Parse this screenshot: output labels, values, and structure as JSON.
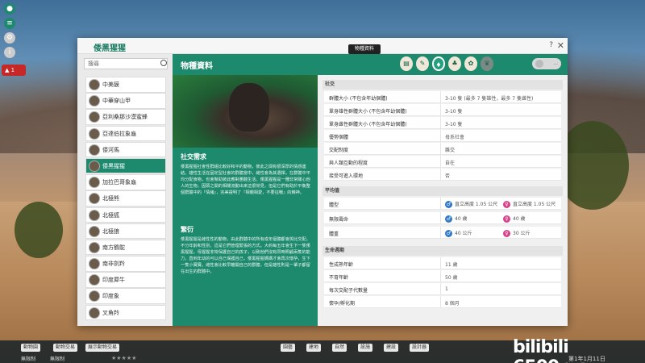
{
  "window": {
    "title": "倭黑猩猩",
    "help": "?",
    "close": "✕"
  },
  "search": {
    "placeholder": "搜尋"
  },
  "species": [
    "中美貘",
    "中華穿山甲",
    "亞利桑那沙漠蜜蜂",
    "亞達伯拉象龜",
    "倭河馬",
    "倭黑猩猩",
    "加拉巴哥象龜",
    "北極熊",
    "北極狐",
    "北極狼",
    "南方鶴鴕",
    "南非劍羚",
    "印度犀牛",
    "印度象",
    "叉角羚"
  ],
  "selected_index": 5,
  "header": {
    "title": "物種資料",
    "tooltip": "物種資料",
    "tabs": [
      "doc-icon",
      "pen-icon",
      "species-icon",
      "tree-icon",
      "paw-icon",
      "trophy-icon"
    ],
    "right_button": "..."
  },
  "info": {
    "social_title": "社交需求",
    "social_text": "倭黑猩猩社會性群組比較好和平的動物，彼此之間有很深厚的情感連結。雄性生活在固定型社會的群體當中，雌性會為其選擇。在群體中平均分配食物，也會幫助彼此應對團體生活。倭黑猩猩是一種非常關心他人的生物，因頭之間的相關流動出來這很常見，但是它們有助於平衡整個群體中的『情緒』，完美證明了『相親相愛，不要征戰』的精神。",
    "breeding_title": "繁衍",
    "breeding_text": "倭黑猩猩是雌性性的動物，由此群體中的所有成年個體都會與比交配，不分年齡和性別，這是它們管理緊張的方式。大約每五年會生下一隻倭黑猩猩，母猩猩非常保護自己的孩子，以致他們沒有同時照顧兩隻的能力，直到年幼的可以自己保護自己，倭黑猩猩媽媽才會再次懷孕，生下一隻小寶寶。雌性會比較早離開自己的群體，但是雄性則是一輩子都留在出生的群體中。"
  },
  "sections": {
    "social": {
      "title": "社交",
      "rows": [
        {
          "k": "群體大小 (不包含年幼個體)",
          "v": "3-10 隻 (最多 7 隻雄性，最多 7 隻雌性)"
        },
        {
          "k": "單身雄性群體大小 (不包含年幼個體)",
          "v": "3-10 隻"
        },
        {
          "k": "單身雌性群體大小 (不包含年幼個體)",
          "v": "3-10 隻"
        },
        {
          "k": "優勢個體",
          "v": "母系社會"
        },
        {
          "k": "交配制度",
          "v": "雜交"
        },
        {
          "k": "與人類互動的程度",
          "v": "自在"
        },
        {
          "k": "接受可進入環地",
          "v": "否"
        }
      ]
    },
    "average": {
      "title": "平均值",
      "rows": [
        {
          "k": "體型",
          "male": "直立高度 1.05 公尺",
          "female": "直立高度 1.05 公尺"
        },
        {
          "k": "無限壽命",
          "male": "40 歲",
          "female": "40 歲"
        },
        {
          "k": "體重",
          "male": "40 公斤",
          "female": "30 公斤"
        }
      ]
    },
    "life": {
      "title": "生命週期",
      "rows": [
        {
          "k": "性成熟年齡",
          "v": "11 歲"
        },
        {
          "k": "不育年齡",
          "v": "50 歲"
        },
        {
          "k": "每次交配子代數量",
          "v": "1"
        },
        {
          "k": "懷孕/孵化期",
          "v": "8 個月"
        }
      ]
    }
  },
  "bottom": {
    "left_buttons": [
      "動物園",
      "動物交易",
      "展示動物交易"
    ],
    "money": "無限制",
    "money2": "無限制",
    "center_buttons": [
      "園藝",
      "建地",
      "自然",
      "設施",
      "建設",
      "設計器"
    ],
    "stars": "★★★★★",
    "date": "第1年1月11日",
    "watermark": "bilibili 6500rya"
  }
}
